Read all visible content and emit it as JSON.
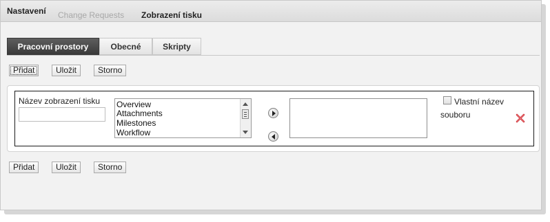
{
  "topnav": {
    "settings": "Nastavení",
    "change_requests": "Change Requests",
    "print_views": "Zobrazení tisku"
  },
  "tabs": [
    {
      "label": "Pracovní prostory",
      "active": true
    },
    {
      "label": "Obecné",
      "active": false
    },
    {
      "label": "Skripty",
      "active": false
    }
  ],
  "actions": {
    "add": "Přidat",
    "save": "Uložit",
    "cancel": "Storno"
  },
  "form": {
    "name_label": "Název zobrazení tisku",
    "name_value": "",
    "available_items": [
      "Overview",
      "Attachments",
      "Milestones",
      "Workflow"
    ],
    "selected_items": [],
    "custom_filename_line1": "Vlastní název",
    "custom_filename_line2": "souboru",
    "custom_filename_checked": false
  },
  "icons": {
    "move_right": "circle-arrow-right-icon",
    "move_left": "circle-arrow-left-icon",
    "delete": "red-x-icon"
  },
  "colors": {
    "active_tab_bg": "#4a4a4a",
    "delete_icon": "#d0343a",
    "page_bg": "#f2f2f2"
  }
}
